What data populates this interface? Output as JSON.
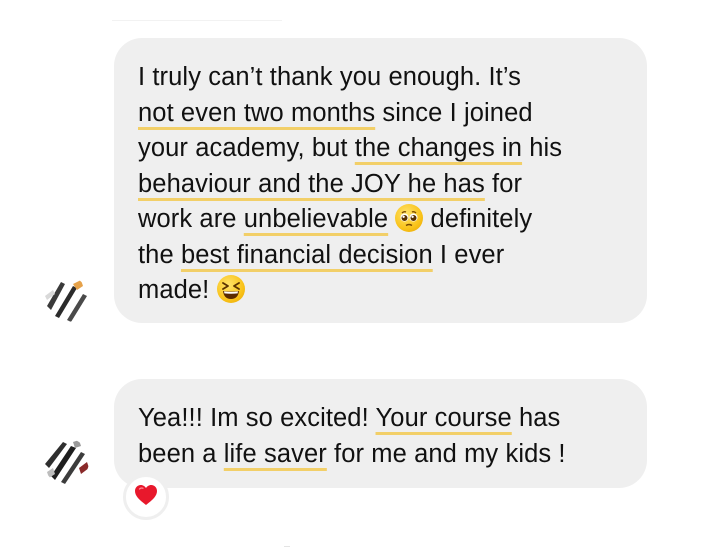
{
  "conversation": {
    "messages": [
      {
        "lines": [
          [
            {
              "text": "I truly can’t thank you enough. It’s",
              "hl": false
            }
          ],
          [
            {
              "text": "not even two months",
              "hl": true
            },
            {
              "text": " since I joined",
              "hl": false
            }
          ],
          [
            {
              "text": "your academy, but ",
              "hl": false
            },
            {
              "text": "the changes in",
              "hl": true
            },
            {
              "text": " his",
              "hl": false
            }
          ],
          [
            {
              "text": "behaviour and the JOY he has",
              "hl": true
            },
            {
              "text": " for",
              "hl": false
            }
          ],
          [
            {
              "text": "work are ",
              "hl": false
            },
            {
              "text": "unbelievable",
              "hl": true
            },
            {
              "emoji": "pleading-face-icon"
            },
            {
              "text": " definitely",
              "hl": false
            }
          ],
          [
            {
              "text": "the ",
              "hl": false
            },
            {
              "text": "best financial decision",
              "hl": true
            },
            {
              "text": " I ever",
              "hl": false
            }
          ],
          [
            {
              "text": "made! ",
              "hl": false
            },
            {
              "emoji": "grinning-squinting-face-icon"
            }
          ]
        ]
      },
      {
        "lines": [
          [
            {
              "text": "Yea!!! Im so excited! ",
              "hl": false
            },
            {
              "text": "Your course",
              "hl": true
            },
            {
              "text": " has",
              "hl": false
            }
          ],
          [
            {
              "text": "been a ",
              "hl": false
            },
            {
              "text": "life saver",
              "hl": true
            },
            {
              "text": " for me and my kids !",
              "hl": false
            }
          ]
        ],
        "reaction": "red-heart-icon"
      }
    ]
  },
  "colors": {
    "bubble_bg": "#efefef",
    "highlight_underline": "#f2cf68",
    "text": "#111111",
    "heart": "#e8182c"
  }
}
